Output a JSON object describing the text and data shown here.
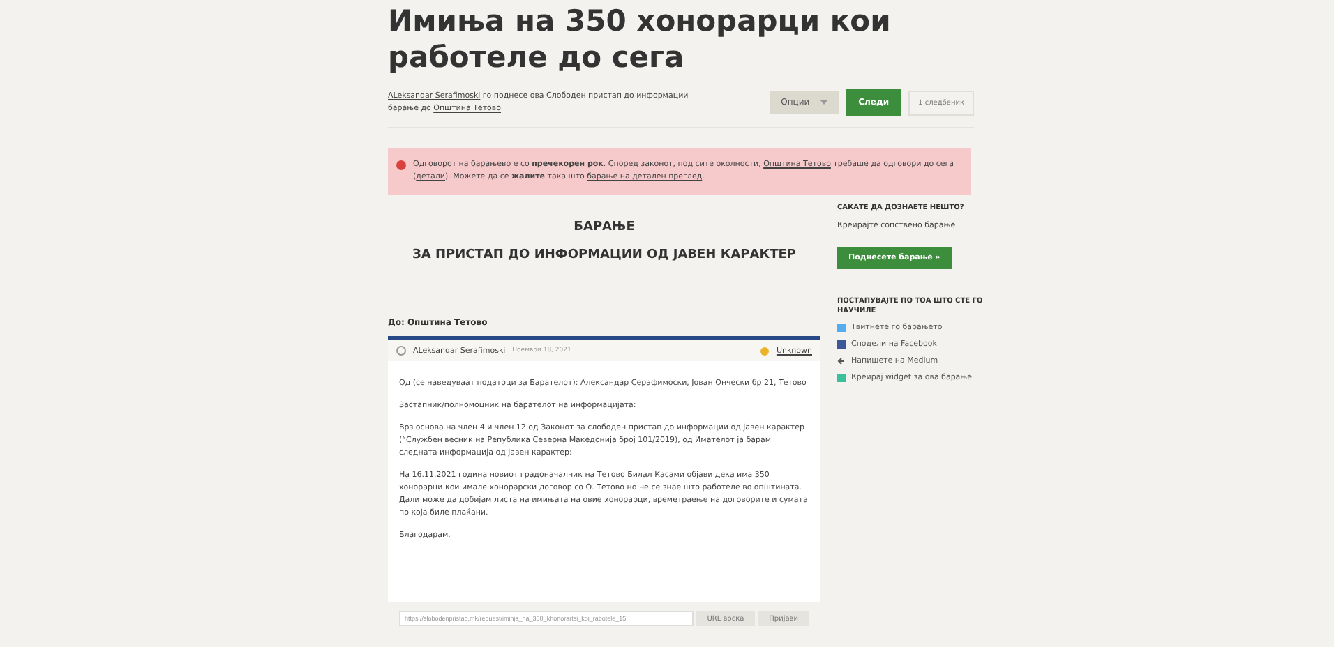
{
  "title": "Имиња на 350 хонорарци кои работеле до сега",
  "meta": [
    {
      "kind": "link",
      "text": "ALeksandar Serafimoski"
    },
    {
      "kind": "text",
      "text": " го поднесе ова Слободен пристап до информации барање до "
    },
    {
      "kind": "link",
      "text": "Општина Тетово"
    }
  ],
  "actions": {
    "options": "Опции",
    "follow": "Следи",
    "followers": "1 следбеник"
  },
  "alert": [
    {
      "kind": "text",
      "text": "Одговорот на барањево е со **пречекорен рок**. Според законот, под сите околности, "
    },
    {
      "kind": "link",
      "text": "Општина Тетово"
    },
    {
      "kind": "text",
      "text": " требаше да одговори до сега ("
    },
    {
      "kind": "link",
      "text": "детали"
    },
    {
      "kind": "text",
      "text": "). Можете да се **жалите** така што "
    },
    {
      "kind": "link",
      "text": "барање на детален преглед"
    },
    {
      "kind": "text",
      "text": "."
    }
  ],
  "heading": [
    "БАРАЊЕ",
    "ЗА ПРИСТАП ДО ИНФОРМАЦИИ ОД ЈАВЕН КАРАКТЕР"
  ],
  "to": "До: Општина Тетово",
  "message": {
    "author": "ALeksandar Serafimoski",
    "date": "Ноември 18, 2021",
    "status": "Unknown",
    "paragraphs": [
      "Од (се наведуваат податоци за Барателот): Александар Серафимоски, Јован Ончески бр 21, Тетово",
      "Застапник/полномоцник на барателот на информацијата:",
      "Врз основа на член 4 и член 12 од Законот за слободен пристап до информации од јавен карактер (“Службен весник на Република Северна Македонија број 101/2019), од Имателот ја барам следната информација од јавен карактер:",
      "На 16.11.2021 година новиот градоначалник на Тетово Билал Касами објави дека има 350 хонорарци кои имале хонорарски договор со О. Тетово но не се знае што работеле во општината. Дали може да добијам листа на имињата на овие хонорарци, времетраење на договорите и сумата по која биле плаќани.",
      "Благодарам."
    ],
    "url": "https://slobodenpristap.mk/request/iminja_na_350_khonorartsi_koi_rabotele_15",
    "url_button": "URL врска",
    "report_button": "Пријави"
  },
  "sidebar": {
    "question": "САКАТЕ ДА ДОЗНАЕТЕ НЕШТО?",
    "create": "Креирајте сопствено барање",
    "submit": "Поднесете барање »",
    "act_title": "ПОСТАПУВАЈТЕ ПО ТОА ШТО СТЕ ГО НАУЧИЛЕ",
    "links": [
      {
        "kind": "twitter",
        "text": "Твитнете го барањето"
      },
      {
        "kind": "facebook",
        "text": "Сподели на Facebook"
      },
      {
        "kind": "medium",
        "text": "Напишете на Medium"
      },
      {
        "kind": "widget",
        "text": "Креирај widget за ова барање"
      }
    ]
  }
}
